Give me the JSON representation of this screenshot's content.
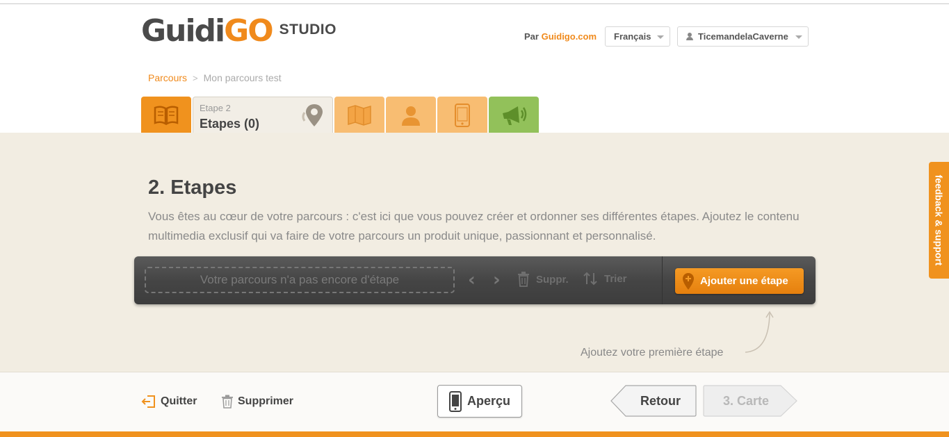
{
  "header": {
    "logo_main": "Guidi",
    "logo_accent": "GO",
    "logo_suffix": "STUDIO",
    "by_prefix": "Par",
    "by_brand": "Guidigo.com",
    "language": "Français",
    "username": "TicemandelaCaverne"
  },
  "breadcrumb": {
    "root": "Parcours",
    "separator": ">",
    "current": "Mon parcours test"
  },
  "tabs": {
    "active_small": "Etape 2",
    "active_big": "Etapes (0)",
    "icons": [
      "book-icon",
      "map-pin-icon",
      "map-icon",
      "person-icon",
      "phone-icon",
      "megaphone-icon"
    ]
  },
  "main": {
    "title": "2. Etapes",
    "intro": "Vous êtes au cœur de votre parcours : c'est ici que vous pouvez créer et ordonner ses différentes étapes. Ajoutez le contenu multimedia exclusif qui va faire de votre parcours un produit unique, passionnant et personnalisé."
  },
  "toolbar": {
    "empty_text": "Votre parcours n'a pas encore d'étape",
    "prev": "‹",
    "next": "›",
    "delete_label": "Suppr.",
    "sort_label": "Trier",
    "add_label": "Ajouter une étape"
  },
  "hint": "Ajoutez votre première étape",
  "feedback": "feedback & support",
  "footer": {
    "quit": "Quitter",
    "delete": "Supprimer",
    "preview": "Aperçu",
    "back": "Retour",
    "next": "3. Carte"
  },
  "colors": {
    "accent": "#f0921e",
    "accent_light": "#f8bd72",
    "green": "#92c15a",
    "beige": "#f2ede2",
    "toolbar_dark": "#454545"
  }
}
